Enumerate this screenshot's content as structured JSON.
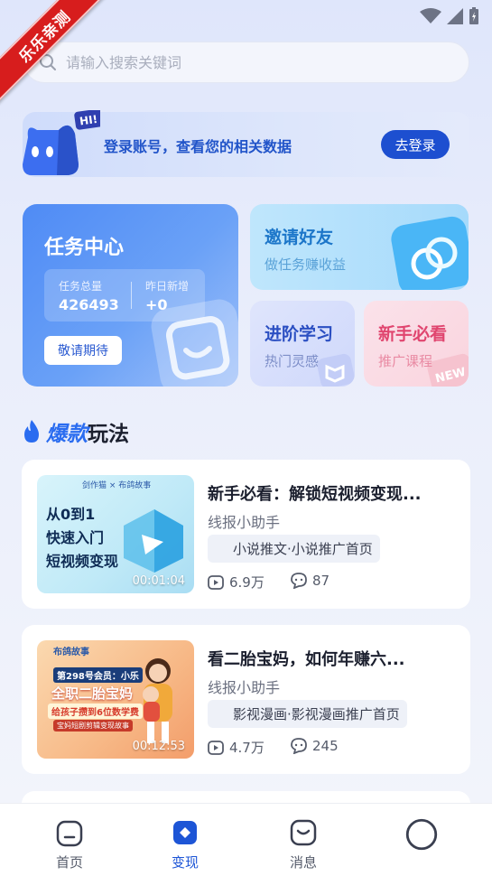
{
  "ribbon": {
    "label": "乐乐亲测"
  },
  "search": {
    "placeholder": "请输入搜索关键词"
  },
  "login_banner": {
    "badge": "HI!",
    "message": "登录账号，查看您的相关数据",
    "button": "去登录"
  },
  "task_center": {
    "title": "任务中心",
    "total_label": "任务总量",
    "total_value": "426493",
    "new_label": "昨日新增",
    "new_value": "+0",
    "button": "敬请期待"
  },
  "invite": {
    "title": "邀请好友",
    "subtitle": "做任务赚收益"
  },
  "learn": {
    "title": "进阶学习",
    "subtitle": "热门灵感"
  },
  "novice": {
    "title": "新手必看",
    "subtitle": "推广课程",
    "badge": "NEW"
  },
  "section": {
    "title_hot": "爆款",
    "title_rest": "玩法"
  },
  "videos": [
    {
      "title": "新手必看：解锁短视频变现...",
      "author": "线报小助手",
      "tag": "小说推文·小说推广首页",
      "views": "6.9万",
      "comments": "87",
      "duration": "00:01:04",
      "thumb_brand": "剑作猫 × 布鸽故事",
      "thumb_lines": [
        "从0到1",
        "快速入门",
        "短视频变现"
      ]
    },
    {
      "title": "看二胎宝妈，如何年赚六...",
      "author": "线报小助手",
      "tag": "影视漫画·影视漫画推广首页",
      "views": "4.7万",
      "comments": "245",
      "duration": "00:12:53",
      "thumb_brand": "布鸽故事",
      "thumb_lines": [
        "第298号会员：小乐",
        "全职二胎宝妈",
        "给孩子攒到6位数学费",
        "宝妈短剧剪辑变现故事"
      ]
    }
  ],
  "tabs": [
    {
      "label": "首页",
      "icon": "home-icon"
    },
    {
      "label": "变现",
      "icon": "monetize-icon"
    },
    {
      "label": "消息",
      "icon": "message-icon"
    },
    {
      "label": "",
      "icon": "profile-icon"
    }
  ],
  "colors": {
    "accent": "#1d55d6",
    "ribbon": "#d71d1d"
  }
}
